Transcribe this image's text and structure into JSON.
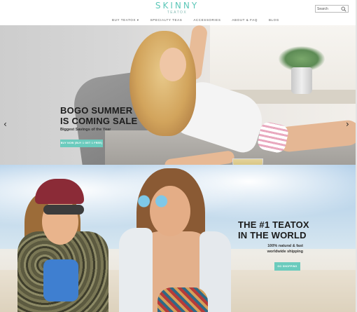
{
  "header": {
    "logo_main": "SKINNY",
    "logo_sub": "TEATOX",
    "search_placeholder": "Search",
    "nav": [
      {
        "label": "BUY TEATOX ▾"
      },
      {
        "label": "SPECIALTY TEAS"
      },
      {
        "label": "ACCESSORIES"
      },
      {
        "label": "ABOUT & FAQ"
      },
      {
        "label": "BLOG"
      }
    ]
  },
  "hero1": {
    "headline_line1": "BOGO SUMMER",
    "headline_line2": "IS COMING SALE",
    "subtitle": "Biggest Savings of the Year",
    "button_label": "BUY NOW (BUY 1 GET 1 FREE)",
    "arrow_left": "‹",
    "arrow_right": "›"
  },
  "hero2": {
    "headline_line1": "THE #1 TEATOX",
    "headline_line2": "IN THE WORLD",
    "subtitle_line1": "100% natural & fast",
    "subtitle_line2": "worldwide shipping",
    "button_label": "GO SHOPPING"
  },
  "colors": {
    "accent": "#6bcbbd",
    "logo": "#5cc7b8",
    "headline": "#1d1d1d"
  }
}
